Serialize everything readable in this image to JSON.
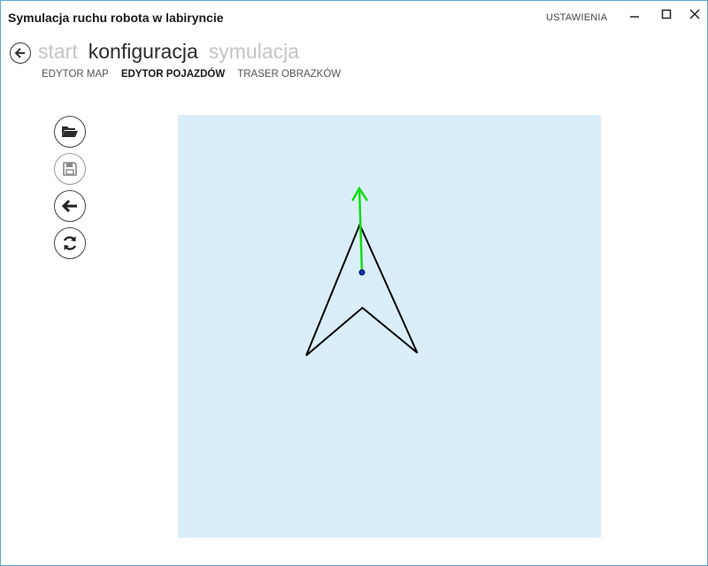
{
  "window": {
    "title": "Symulacja ruchu robota w labiryncie",
    "settings_label": "USTAWIENIA"
  },
  "breadcrumb": {
    "items": [
      {
        "label": "start",
        "active": false
      },
      {
        "label": "konfiguracja",
        "active": true
      },
      {
        "label": "symulacja",
        "active": false
      }
    ]
  },
  "subtabs": [
    {
      "label": "EDYTOR MAP",
      "active": false
    },
    {
      "label": "EDYTOR POJAZDÓW",
      "active": true
    },
    {
      "label": "TRASER OBRAZKÓW",
      "active": false
    }
  ],
  "toolbar": {
    "buttons": [
      {
        "name": "open-button",
        "icon": "folder-open-icon",
        "enabled": true
      },
      {
        "name": "save-button",
        "icon": "floppy-disk-icon",
        "enabled": false
      },
      {
        "name": "undo-button",
        "icon": "arrow-left-icon",
        "enabled": true
      },
      {
        "name": "refresh-button",
        "icon": "refresh-icon",
        "enabled": true
      }
    ]
  },
  "colors": {
    "canvas_bg": "#daeefa",
    "vehicle_outline": "#000000",
    "direction_arrow": "#11dd11",
    "center_point": "#1133aa",
    "accent_border": "#5aa6d6"
  }
}
